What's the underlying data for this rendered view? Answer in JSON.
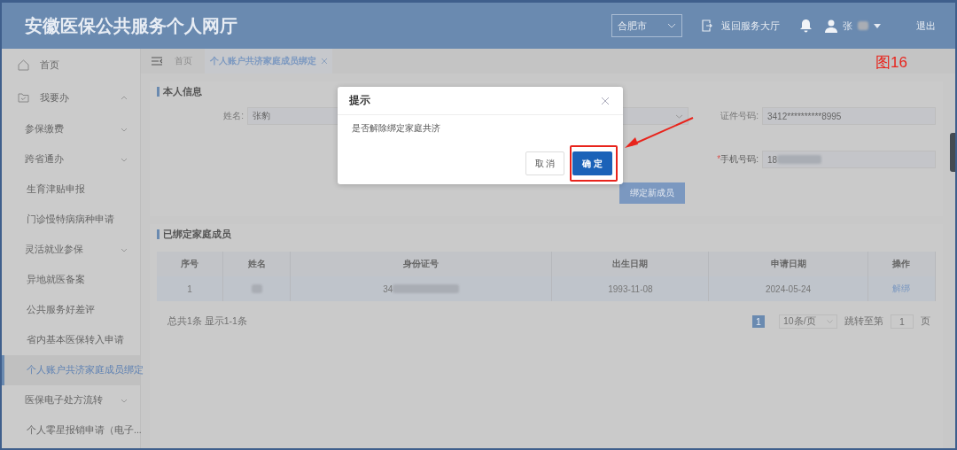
{
  "header": {
    "title": "安徽医保公共服务个人网厅",
    "city_select": {
      "value": "合肥市"
    },
    "back_link": "返回服务大厅",
    "user_name": "张",
    "user_name_masked": true,
    "logout": "退出"
  },
  "sidebar": {
    "items": [
      {
        "label": "首页",
        "kind": "home",
        "selected": false
      },
      {
        "label": "我要办",
        "kind": "folder",
        "expanded": true,
        "selected": false,
        "children": [
          {
            "label": "参保缴费",
            "expanded": false,
            "selected": false
          },
          {
            "label": "跨省通办",
            "expanded": false,
            "selected": false
          },
          {
            "label": "生育津贴申报",
            "selected": false
          },
          {
            "label": "门诊慢特病病种申请",
            "selected": false
          },
          {
            "label": "灵活就业参保",
            "expanded": false,
            "selected": false
          },
          {
            "label": "异地就医备案",
            "selected": false
          },
          {
            "label": "公共服务好差评",
            "selected": false
          },
          {
            "label": "省内基本医保转入申请",
            "selected": false
          },
          {
            "label": "个人账户共济家庭成员绑定",
            "selected": true
          },
          {
            "label": "医保电子处方流转",
            "expanded": false,
            "selected": false
          },
          {
            "label": "个人零星报销申请（电子...",
            "selected": false
          }
        ]
      }
    ]
  },
  "breadcrumb": {
    "home": "首页",
    "tabs": [
      {
        "label": "个人账户共济家庭成员绑定",
        "selected": true,
        "closable": true
      }
    ]
  },
  "personal_info": {
    "title": "本人信息",
    "fields": [
      {
        "label": "姓名:",
        "value": "张豹",
        "kind": "text",
        "required": false,
        "masked": false
      },
      {
        "kind": "select",
        "required": false
      },
      {
        "label": "证件号码:",
        "value": "3412**********8995",
        "kind": "text",
        "required": false,
        "masked": false
      },
      {
        "label": "手机号码:",
        "value": "18",
        "kind": "text",
        "required": true,
        "masked": true,
        "required_mark": "*"
      }
    ],
    "bind_button": "绑定新成员"
  },
  "members": {
    "title": "已绑定家庭成员",
    "columns": [
      "序号",
      "姓名",
      "身份证号",
      "出生日期",
      "申请日期",
      "操作"
    ],
    "rows": [
      {
        "index": "1",
        "name_masked": true,
        "id_number": "34",
        "id_masked": true,
        "birth_date": "1993-11-08",
        "apply_date": "2024-05-24",
        "action": "解绑"
      }
    ],
    "summary": "总共1条 显示1-1条",
    "pagination": {
      "pages": [
        {
          "label": "1",
          "selected": true
        }
      ],
      "page_size": "10条/页",
      "jump_label": "跳转至第",
      "jump_value": "1",
      "page_unit": "页"
    }
  },
  "dialog": {
    "title": "提示",
    "message": "是否解除绑定家庭共济",
    "buttons": [
      {
        "label": "取 消",
        "kind": "secondary"
      },
      {
        "label": "确 定",
        "kind": "primary",
        "highlighted": true
      }
    ]
  },
  "annotation": {
    "figure_label": "图16"
  }
}
